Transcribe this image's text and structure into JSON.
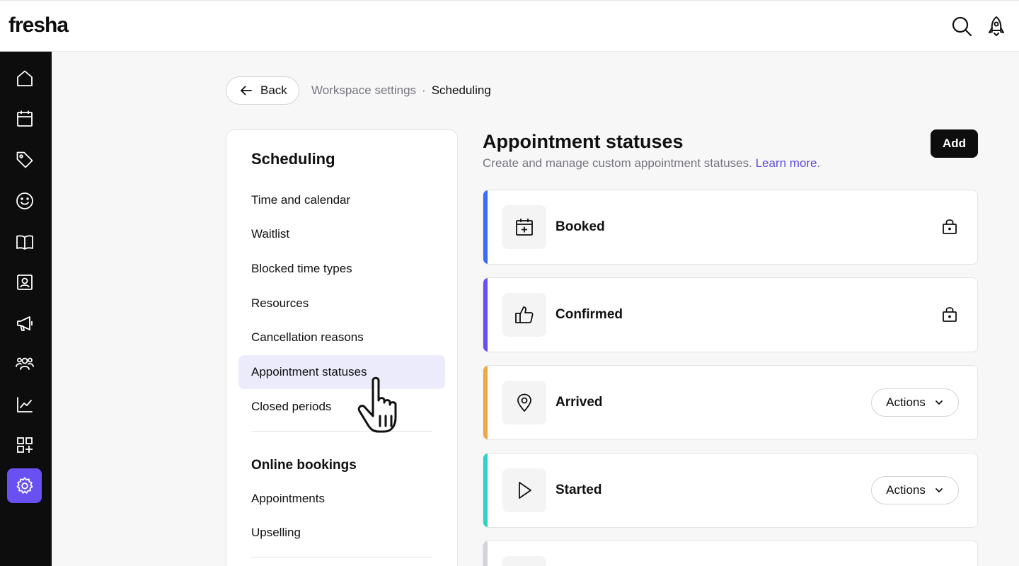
{
  "app": {
    "logo": "fresha"
  },
  "topbar": {
    "icons": [
      "search-icon",
      "notifications-rocket-icon"
    ]
  },
  "sidebar": {
    "items": [
      {
        "name": "home-icon",
        "active": false
      },
      {
        "name": "calendar-icon",
        "active": false
      },
      {
        "name": "sales-tag-icon",
        "active": false
      },
      {
        "name": "clients-smiley-icon",
        "active": false
      },
      {
        "name": "catalog-book-icon",
        "active": false
      },
      {
        "name": "team-badge-icon",
        "active": false
      },
      {
        "name": "marketing-megaphone-icon",
        "active": false
      },
      {
        "name": "team-members-icon",
        "active": false
      },
      {
        "name": "reports-chart-icon",
        "active": false
      },
      {
        "name": "add-ons-grid-icon",
        "active": false
      },
      {
        "name": "settings-gear-icon",
        "active": true
      }
    ],
    "active_color": "#6950f3"
  },
  "header": {
    "back_label": "Back",
    "breadcrumb": [
      "Workspace settings",
      "Scheduling"
    ],
    "breadcrumb_sep": "·"
  },
  "settings_nav": {
    "sections": [
      {
        "heading": "Scheduling",
        "items": [
          "Time and calendar",
          "Waitlist",
          "Blocked time types",
          "Resources",
          "Cancellation reasons",
          "Appointment statuses",
          "Closed periods"
        ]
      },
      {
        "heading": "Online bookings",
        "items": [
          "Appointments",
          "Upselling"
        ]
      }
    ],
    "active_item": "Appointment statuses"
  },
  "main": {
    "title": "Appointment statuses",
    "subtitle": "Create and manage custom appointment statuses.",
    "learn_more": "Learn more",
    "subtitle_end": ".",
    "add_label": "Add",
    "actions_label": "Actions",
    "statuses": [
      {
        "name": "Booked",
        "color": "#3b6cf6",
        "icon": "calendar-plus-icon",
        "locked": true
      },
      {
        "name": "Confirmed",
        "color": "#6950f3",
        "icon": "thumbs-up-icon",
        "locked": true
      },
      {
        "name": "Arrived",
        "color": "#f2a546",
        "icon": "map-pin-icon",
        "locked": false
      },
      {
        "name": "Started",
        "color": "#2ed3c6",
        "icon": "play-icon",
        "locked": false
      },
      {
        "name": "",
        "color": "#d4d4d8",
        "icon": "",
        "locked": false
      }
    ]
  }
}
